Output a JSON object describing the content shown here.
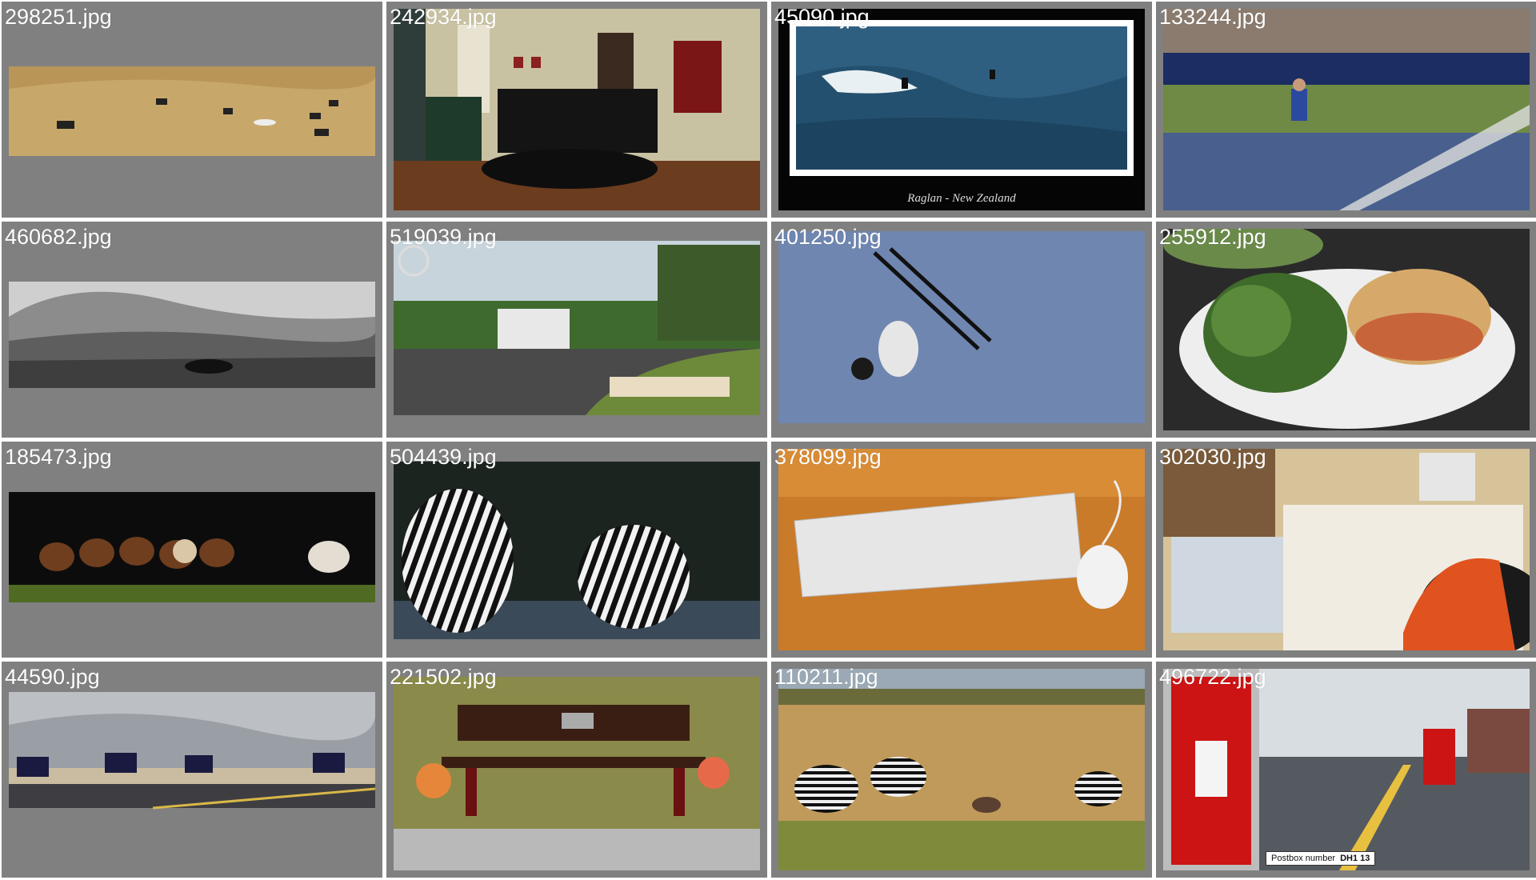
{
  "grid": {
    "background": "#808080",
    "cells": [
      {
        "filename": "298251.jpg",
        "scene": "zebras-grassland"
      },
      {
        "filename": "242934.jpg",
        "scene": "living-room"
      },
      {
        "filename": "45090.jpg",
        "scene": "surfers-wave",
        "caption": "Raglan - New Zealand"
      },
      {
        "filename": "133244.jpg",
        "scene": "tennis-match"
      },
      {
        "filename": "460682.jpg",
        "scene": "bw-horse-landscape"
      },
      {
        "filename": "519039.jpg",
        "scene": "street-garbage-truck"
      },
      {
        "filename": "401250.jpg",
        "scene": "aerial-skier"
      },
      {
        "filename": "255912.jpg",
        "scene": "sandwich-salad"
      },
      {
        "filename": "185473.jpg",
        "scene": "horse-herd"
      },
      {
        "filename": "504439.jpg",
        "scene": "two-zebras"
      },
      {
        "filename": "378099.jpg",
        "scene": "keyboard-mouse"
      },
      {
        "filename": "302030.jpg",
        "scene": "messy-desk"
      },
      {
        "filename": "44590.jpg",
        "scene": "motorcycles-road"
      },
      {
        "filename": "221502.jpg",
        "scene": "memorial-bench"
      },
      {
        "filename": "110211.jpg",
        "scene": "zebras-savanna"
      },
      {
        "filename": "496722.jpg",
        "scene": "red-postbox",
        "postbox_label": "Postbox number",
        "postbox_number": "DH1 13"
      }
    ]
  }
}
